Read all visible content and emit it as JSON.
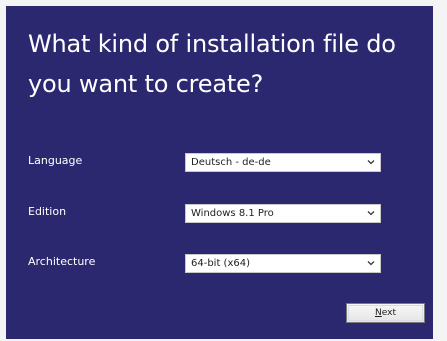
{
  "dialog": {
    "heading_line1": "What kind of installation file do",
    "heading_line2": "you want to create?",
    "background_color": "#2c2870"
  },
  "fields": [
    {
      "label": "Language",
      "selected": "Deutsch - de-de"
    },
    {
      "label": "Edition",
      "selected": "Windows 8.1 Pro"
    },
    {
      "label": "Architecture",
      "selected": "64-bit (x64)"
    }
  ],
  "icons": {
    "dropdown": "chevron-down-icon"
  },
  "buttons": {
    "next_mnemonic": "N",
    "next_rest": "ext"
  }
}
